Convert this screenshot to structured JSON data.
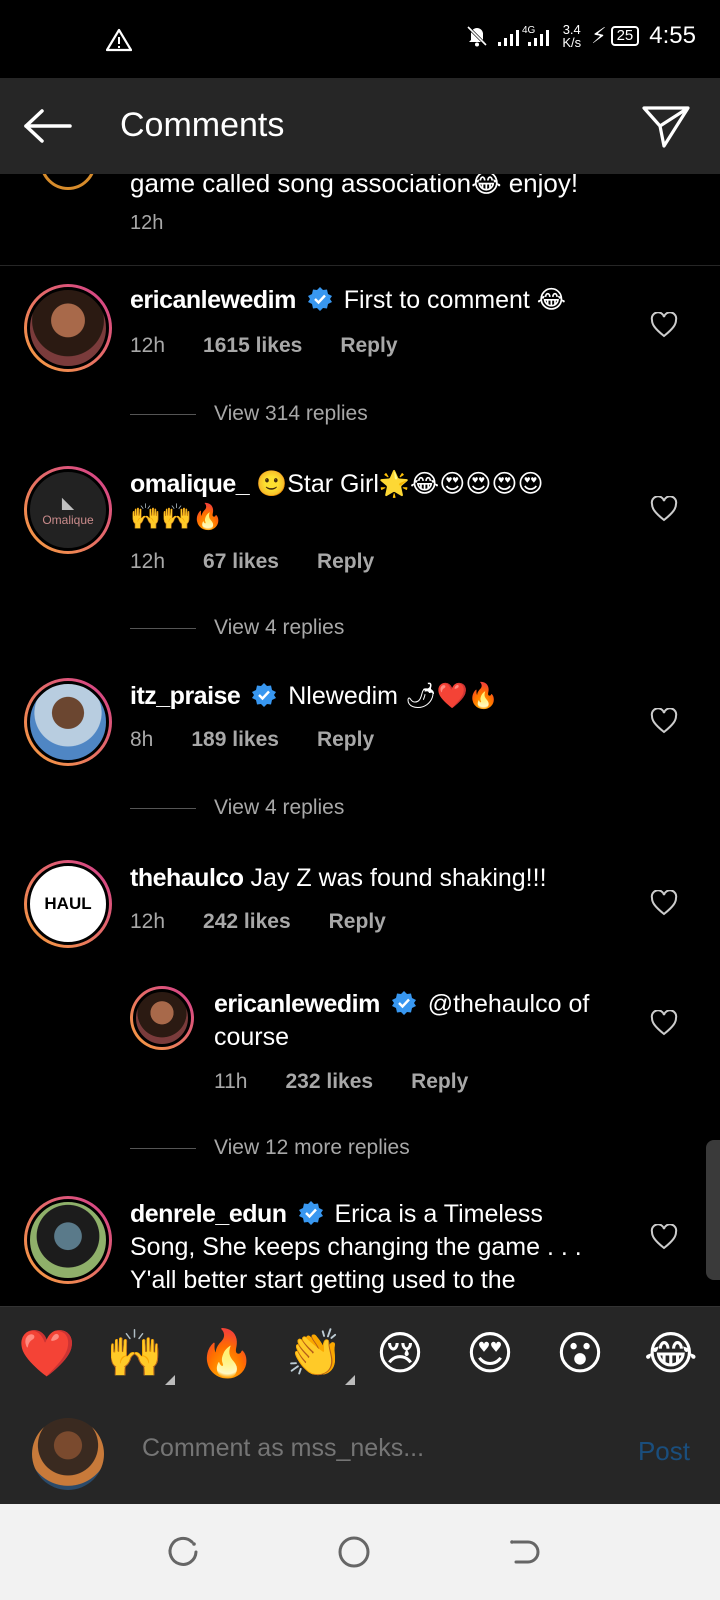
{
  "status": {
    "time": "4:55",
    "network": "4G",
    "speed_value": "3.4",
    "speed_unit": "K/s",
    "battery": "25"
  },
  "header": {
    "title": "Comments",
    "back_icon": "arrow-left-icon",
    "send_icon": "paper-plane-icon"
  },
  "caption": {
    "text": "game called song association😂 enjoy!",
    "time": "12h"
  },
  "comments": [
    {
      "username": "ericanlewedim",
      "verified": true,
      "text": "First to comment 😂",
      "time": "12h",
      "likes": "1615 likes",
      "reply_label": "Reply",
      "view_replies": "View 314 replies"
    },
    {
      "username": "omalique_",
      "verified": false,
      "text": "🙂Star Girl🌟😂😍😍😍😍",
      "text_line2": "🙌🙌🔥",
      "avatar_text": "Omalique",
      "time": "12h",
      "likes": "67 likes",
      "reply_label": "Reply",
      "view_replies": "View 4 replies"
    },
    {
      "username": "itz_praise",
      "verified": true,
      "text": "Nlewedim 🌶❤️🔥",
      "time": "8h",
      "likes": "189 likes",
      "reply_label": "Reply",
      "view_replies": "View 4 replies"
    },
    {
      "username": "thehaulco",
      "verified": false,
      "text": "Jay Z was found shaking!!!",
      "avatar_text": "HAUL",
      "time": "12h",
      "likes": "242 likes",
      "reply_label": "Reply"
    },
    {
      "username": "ericanlewedim",
      "verified": true,
      "text": "@thehaulco of",
      "text_line2": "course",
      "time": "11h",
      "likes": "232 likes",
      "reply_label": "Reply",
      "view_replies": "View 12 more replies"
    },
    {
      "username": "denrele_edun",
      "verified": true,
      "text": "Erica is a Timeless",
      "text_line2": "Song, She keeps changing the game . . .",
      "text_line3": "Y'all better start getting used to the"
    }
  ],
  "reactions": [
    "❤️",
    "🙌",
    "🔥",
    "👏",
    "😢",
    "😍",
    "😮",
    "😂"
  ],
  "composer": {
    "placeholder": "Comment as mss_neks...",
    "post_label": "Post"
  },
  "colors": {
    "background": "#000000",
    "panel": "#262626",
    "verified": "#3897f0",
    "secondary_text": "#a8a8a8",
    "post_disabled": "#1a4e7d"
  }
}
